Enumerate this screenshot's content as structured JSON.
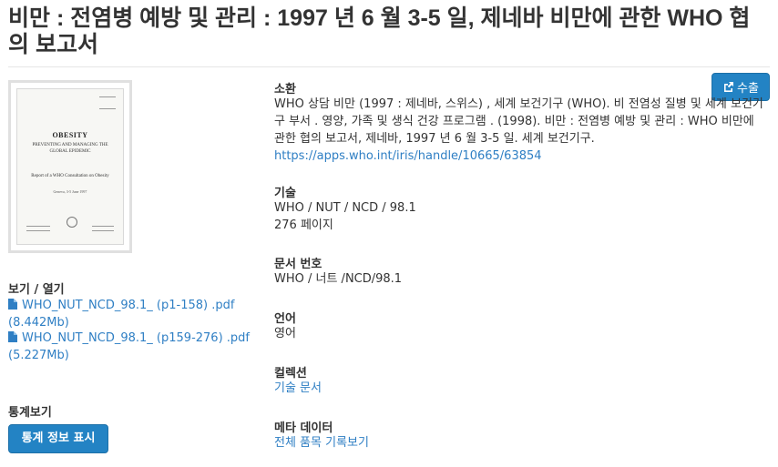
{
  "page_title": "비만 : 전염병 예방 및 관리 : 1997 년 6 월 3-5 일, 제네바 비만에 관한 WHO 협의 보고서",
  "thumbnail": {
    "title": "OBESITY",
    "subtitle": "PREVENTING AND MANAGING THE GLOBAL EPIDEMIC",
    "report": "Report of a WHO Consultation on Obesity",
    "date": "Geneva, 3-5 June 1997"
  },
  "view_open": {
    "label": "보기 / 열기",
    "files": [
      {
        "name": "WHO_NUT_NCD_98.1_ (p1-158) .pdf",
        "size": "(8.442Mb)"
      },
      {
        "name": "WHO_NUT_NCD_98.1_ (p159-276) .pdf",
        "size": "(5.227Mb)"
      }
    ]
  },
  "stats": {
    "label": "통계보기",
    "button": "통계 정보 표시"
  },
  "export": {
    "label": "수출"
  },
  "citation": {
    "label": "소환",
    "text": "WHO 상담 비만 (1997 : 제네바, 스위스) , 세계 보건기구 (WHO). 비 전염성 질병 및 세계 보건기구 부서 . 영양, 가족 및 생식 건강 프로그램 . (1998). 비만 : 전염병 예방 및 관리 : WHO 비만에 관한 협의 보고서, 제네바, 1997 년 6 월 3-5 일. 세계 보건기구.",
    "url": "https://apps.who.int/iris/handle/10665/63854"
  },
  "description": {
    "label": "기술",
    "line1": "WHO / NUT / NCD / 98.1",
    "line2": "276 페이지"
  },
  "doc_number": {
    "label": "문서 번호",
    "value": "WHO / 너트 /NCD/98.1"
  },
  "language": {
    "label": "언어",
    "value": "영어"
  },
  "collection": {
    "label": "컬렉션",
    "link": "기술 문서"
  },
  "metadata": {
    "label": "메타 데이터",
    "link": "전체 품목 기록보기"
  },
  "colors": {
    "link": "#2f7fc4",
    "button": "#2383c4"
  }
}
